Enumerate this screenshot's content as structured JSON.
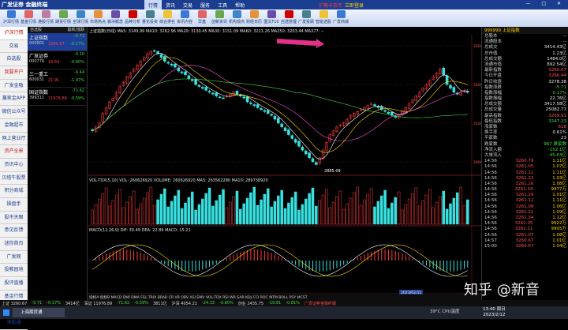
{
  "app": {
    "brand": "广发证券 金融终端",
    "window_buttons": "— □ ✕"
  },
  "menu": {
    "items": [
      "行情",
      "资讯",
      "交易",
      "服务",
      "工具",
      "帮助"
    ],
    "active": 0,
    "alert": "沪期卡货币",
    "login": "立即登录"
  },
  "toolbar": {
    "items": [
      {
        "label": "沪深行情",
        "color": "#3c78d8"
      },
      {
        "label": "基金行情",
        "color": "#e06666"
      },
      {
        "label": "港股行情",
        "color": "#c27ba0"
      },
      {
        "label": "期货行情",
        "color": "#6aa84f"
      },
      {
        "label": "全球行情",
        "color": "#3d85c6"
      },
      {
        "label": "市场热点",
        "color": "#e69138"
      },
      {
        "label": "板块概念",
        "color": "#674ea7"
      },
      {
        "label": "品种分析",
        "color": "#cc0000"
      },
      {
        "label": "量化投资",
        "color": "#45818e"
      },
      {
        "label": "综合排名",
        "color": "#f1c232"
      },
      {
        "label": "资讯内容",
        "color": "#3c78d8"
      },
      {
        "label": "早盘",
        "color": "#e06666"
      },
      {
        "label": "创新资讯",
        "color": "#6aa84f"
      },
      {
        "label": "机构观点",
        "color": "#3d85c6"
      },
      {
        "label": "财经日历",
        "color": "#e69138"
      },
      {
        "label": "图文F10",
        "color": "#674ea7"
      },
      {
        "label": "自选管理",
        "color": "#cc0000"
      },
      {
        "label": "广发投顾",
        "color": "#45818e"
      },
      {
        "label": "智能选股",
        "color": "#f1c232"
      },
      {
        "label": "广发商城",
        "color": "#3c78d8"
      }
    ]
  },
  "sidebar": {
    "items": [
      {
        "label": "沪深行情",
        "style": "act"
      },
      {
        "label": "交易",
        "style": ""
      },
      {
        "label": "自选股",
        "style": ""
      },
      {
        "label": "我要开户",
        "style": "red"
      },
      {
        "label": "广发金融",
        "style": ""
      },
      {
        "label": "赢家金APP",
        "style": ""
      },
      {
        "label": "微信公众号",
        "style": ""
      },
      {
        "label": "金融超市",
        "style": ""
      },
      {
        "label": "网上营业厅",
        "style": ""
      },
      {
        "label": "资产全景",
        "style": "red"
      },
      {
        "label": "资讯中心",
        "style": ""
      },
      {
        "label": "贝塔牛股票",
        "style": ""
      },
      {
        "label": "积分商城",
        "style": ""
      },
      {
        "label": "操盘手",
        "style": ""
      },
      {
        "label": "股市天眼",
        "style": ""
      },
      {
        "label": "意见反馈",
        "style": ""
      },
      {
        "label": "迷你首页",
        "style": ""
      },
      {
        "label": "广发网",
        "style": ""
      },
      {
        "label": "投教园地",
        "style": ""
      },
      {
        "label": "股评直播",
        "style": ""
      },
      {
        "label": "基金行情",
        "style": ""
      },
      {
        "label": "期货行情",
        "style": ""
      },
      {
        "label": "港股通",
        "style": ""
      }
    ]
  },
  "watchlist": {
    "header": {
      "name": "自选股",
      "change": "最新/涨跌"
    },
    "rows": [
      {
        "name": "上证指数",
        "code": "000001",
        "price": "3260.67",
        "change": "-5.71",
        "pct": "-0.17%",
        "selected": true
      },
      {
        "name": "广发证券",
        "code": "000776",
        "price": "16.64",
        "change": "-0.10",
        "pct": "-0.60%",
        "selected": false
      },
      {
        "name": "三一重工",
        "code": "600031",
        "price": "21.91",
        "change": "-0.44",
        "pct": "-1.97%",
        "selected": false
      },
      {
        "name": "国证指数",
        "code": "399311",
        "price": "11976.89",
        "change": "-71.62",
        "pct": "-0.59%",
        "selected": false
      }
    ]
  },
  "chart": {
    "header": "上证指数(日线)  MA5: 3149.99  MA10: 3262.96  MA20: 3130.45  MA30: 3151.09  MA60: 3221.26  MA250: 3203.44  MA377: --",
    "vol_header": "VOL-TDX(5,10)  VOL: 260626920  VOLUME: 260626920  MA5: 263562280  MA10: 289738920",
    "macd_header": "MACD(12,26,9)  DIF: 30.49  DEA: 22.89  MACD: 15.21",
    "tabs": "指标A  指标B  MACD  DMI  DMA  FSL  TRIX  BRAR  CR  VR  OBV  ASI  EMV  VOL-TDX  RSI  WR  SAR  KDJ  CCI  ROC  MTM  BOLL  PSY  MCST",
    "min_label": "2885.09",
    "date_label": "2023/02/12",
    "axis": [
      "3500",
      "3300",
      "3100",
      "2900"
    ]
  },
  "chart_data": {
    "type": "candlestick",
    "title": "上证指数(日线)",
    "x": [
      1,
      2,
      3,
      4,
      5,
      6,
      7,
      8,
      9,
      10,
      11,
      12,
      13,
      14,
      15,
      16,
      17,
      18,
      19,
      20,
      21,
      22,
      23,
      24,
      25,
      26,
      27,
      28,
      29,
      30,
      31,
      32,
      33,
      34,
      35,
      36,
      37,
      38,
      39,
      40,
      41,
      42,
      43,
      44,
      45,
      46,
      47,
      48,
      49,
      50,
      51,
      52,
      53,
      54,
      55,
      56,
      57,
      58,
      59,
      60,
      61,
      62,
      63,
      64,
      65,
      66,
      67,
      68,
      69,
      70,
      71,
      72,
      73,
      74,
      75,
      76,
      77,
      78,
      79,
      80,
      81,
      82,
      83,
      84,
      85,
      86,
      87,
      88,
      89,
      90,
      91,
      92,
      93,
      94,
      95,
      96,
      97,
      98,
      99,
      100,
      101,
      102,
      103,
      104,
      105,
      106,
      107,
      108,
      109,
      110
    ],
    "close": [
      3060,
      3080,
      3100,
      3150,
      3180,
      3210,
      3230,
      3260,
      3290,
      3310,
      3340,
      3360,
      3380,
      3400,
      3420,
      3440,
      3460,
      3470,
      3475,
      3460,
      3440,
      3420,
      3410,
      3400,
      3390,
      3370,
      3360,
      3350,
      3330,
      3320,
      3300,
      3290,
      3280,
      3270,
      3260,
      3250,
      3240,
      3235,
      3230,
      3240,
      3250,
      3260,
      3250,
      3240,
      3230,
      3210,
      3200,
      3190,
      3180,
      3170,
      3160,
      3150,
      3140,
      3120,
      3100,
      3080,
      3060,
      3040,
      3020,
      3000,
      2980,
      2960,
      2940,
      2920,
      2900,
      2885,
      2920,
      2960,
      3000,
      3040,
      3060,
      3080,
      3090,
      3100,
      3120,
      3140,
      3150,
      3160,
      3170,
      3180,
      3190,
      3200,
      3190,
      3180,
      3170,
      3160,
      3150,
      3140,
      3130,
      3140,
      3160,
      3180,
      3200,
      3220,
      3240,
      3260,
      3280,
      3300,
      3320,
      3340,
      3360,
      3380,
      3350,
      3300,
      3280,
      3260,
      3250,
      3260,
      3270,
      3260
    ],
    "ylim": [
      2850,
      3550
    ]
  },
  "right_panel": {
    "title": "999999 上证指数",
    "stats": [
      {
        "k": "总股本",
        "v": "--",
        "c": "w"
      },
      {
        "k": "流通股本",
        "v": "--",
        "c": "w"
      },
      {
        "k": "总成交",
        "v": "3414.43亿",
        "c": "w"
      },
      {
        "k": "总市值",
        "v": "1.23亿",
        "c": "w"
      },
      {
        "k": "总成交额",
        "v": "1484.0亿",
        "c": "w"
      },
      {
        "k": "流通市值",
        "v": "892.54亿",
        "c": "w"
      },
      {
        "k": "最新指数",
        "v": "3260.67",
        "c": "r"
      },
      {
        "k": "今日开盘",
        "v": "3266.44",
        "c": "r"
      },
      {
        "k": "昨日收盘",
        "v": "3278.38",
        "c": "w"
      },
      {
        "k": "指数涨跌",
        "v": "-5.71",
        "c": "g"
      },
      {
        "k": "指数涨幅",
        "v": "-0.17%",
        "c": "g"
      },
      {
        "k": "指数振幅",
        "v": "22.76亿",
        "c": "w"
      },
      {
        "k": "总成交额",
        "v": "3417.58亿",
        "c": "w"
      },
      {
        "k": "总成交量",
        "v": "25082.77",
        "c": "w"
      },
      {
        "k": "最高指数",
        "v": "3269.91",
        "c": "r"
      },
      {
        "k": "最低指数",
        "v": "3247.23",
        "c": "g"
      },
      {
        "k": "涨家数",
        "v": "618",
        "c": "r"
      },
      {
        "k": "换手率",
        "v": "0.61%",
        "c": "w"
      },
      {
        "k": "平家数",
        "v": "23",
        "c": "w"
      },
      {
        "k": "跌家数",
        "v": "967 跌家数",
        "c": "g"
      },
      {
        "k": "净流入额",
        "v": "-152.1亿",
        "c": "g"
      },
      {
        "k": "大单流入",
        "v": "-45.63亿",
        "c": "g"
      }
    ],
    "ticks": [
      {
        "t": "14:56",
        "p": "3260.79",
        "v": "1.11亿"
      },
      {
        "t": "14:56",
        "p": "3261.05",
        "v": "1.07亿"
      },
      {
        "t": "14:56",
        "p": "3261.11",
        "v": "1.11亿"
      },
      {
        "t": "14:56",
        "p": "3261.23",
        "v": "1.03亿"
      },
      {
        "t": "14:56",
        "p": "3261.26",
        "v": "1.08亿"
      },
      {
        "t": "14:56",
        "p": "3261.34",
        "v": "9977万"
      },
      {
        "t": "14:56",
        "p": "3261.29",
        "v": "1.01亿"
      },
      {
        "t": "14:56",
        "p": "3261.12",
        "v": "1.11亿"
      },
      {
        "t": "14:56",
        "p": "3261.08",
        "v": "1.06亿"
      },
      {
        "t": "14:56",
        "p": "3261.21",
        "v": "1.09亿"
      },
      {
        "t": "14:56",
        "p": "3261.34",
        "v": "1.12亿"
      },
      {
        "t": "14:56",
        "p": "3261.05",
        "v": "9922万"
      },
      {
        "t": "14:56",
        "p": "3261.11",
        "v": "9905万"
      },
      {
        "t": "14:56",
        "p": "3261.07",
        "v": "1.08亿"
      },
      {
        "t": "14:57",
        "p": "3260.67",
        "v": "1.01亿"
      },
      {
        "t": "15:00",
        "p": "3260.67",
        "v": "1.04亿"
      }
    ]
  },
  "statusbar": [
    {
      "t": "上证 3260.67",
      "c": ""
    },
    {
      "t": "-5.71",
      "c": "g"
    },
    {
      "t": "-0.17%",
      "c": "g"
    },
    {
      "t": "3414亿",
      "c": ""
    },
    {
      "t": "深证 11976.89",
      "c": ""
    },
    {
      "t": "-71.62",
      "c": "g"
    },
    {
      "t": "-0.59%",
      "c": "g"
    },
    {
      "t": "3811亿",
      "c": ""
    },
    {
      "t": "沪深 4054.21",
      "c": ""
    },
    {
      "t": "-24.33",
      "c": "g"
    },
    {
      "t": "-0.60%",
      "c": "g"
    },
    {
      "t": "创业 2435.75",
      "c": ""
    },
    {
      "t": "-19.81",
      "c": "g"
    },
    {
      "t": "-0.81%",
      "c": "g"
    },
    {
      "t": "广发证券金融终端",
      "c": "r"
    }
  ],
  "taskbar": {
    "app": "上海期货通",
    "weather": "39°C",
    "weather_label": "CPU温度",
    "time": "13:40 周日",
    "date": "2023/2/12",
    "network": "风墙网通"
  },
  "watermark": "知乎 @新音"
}
